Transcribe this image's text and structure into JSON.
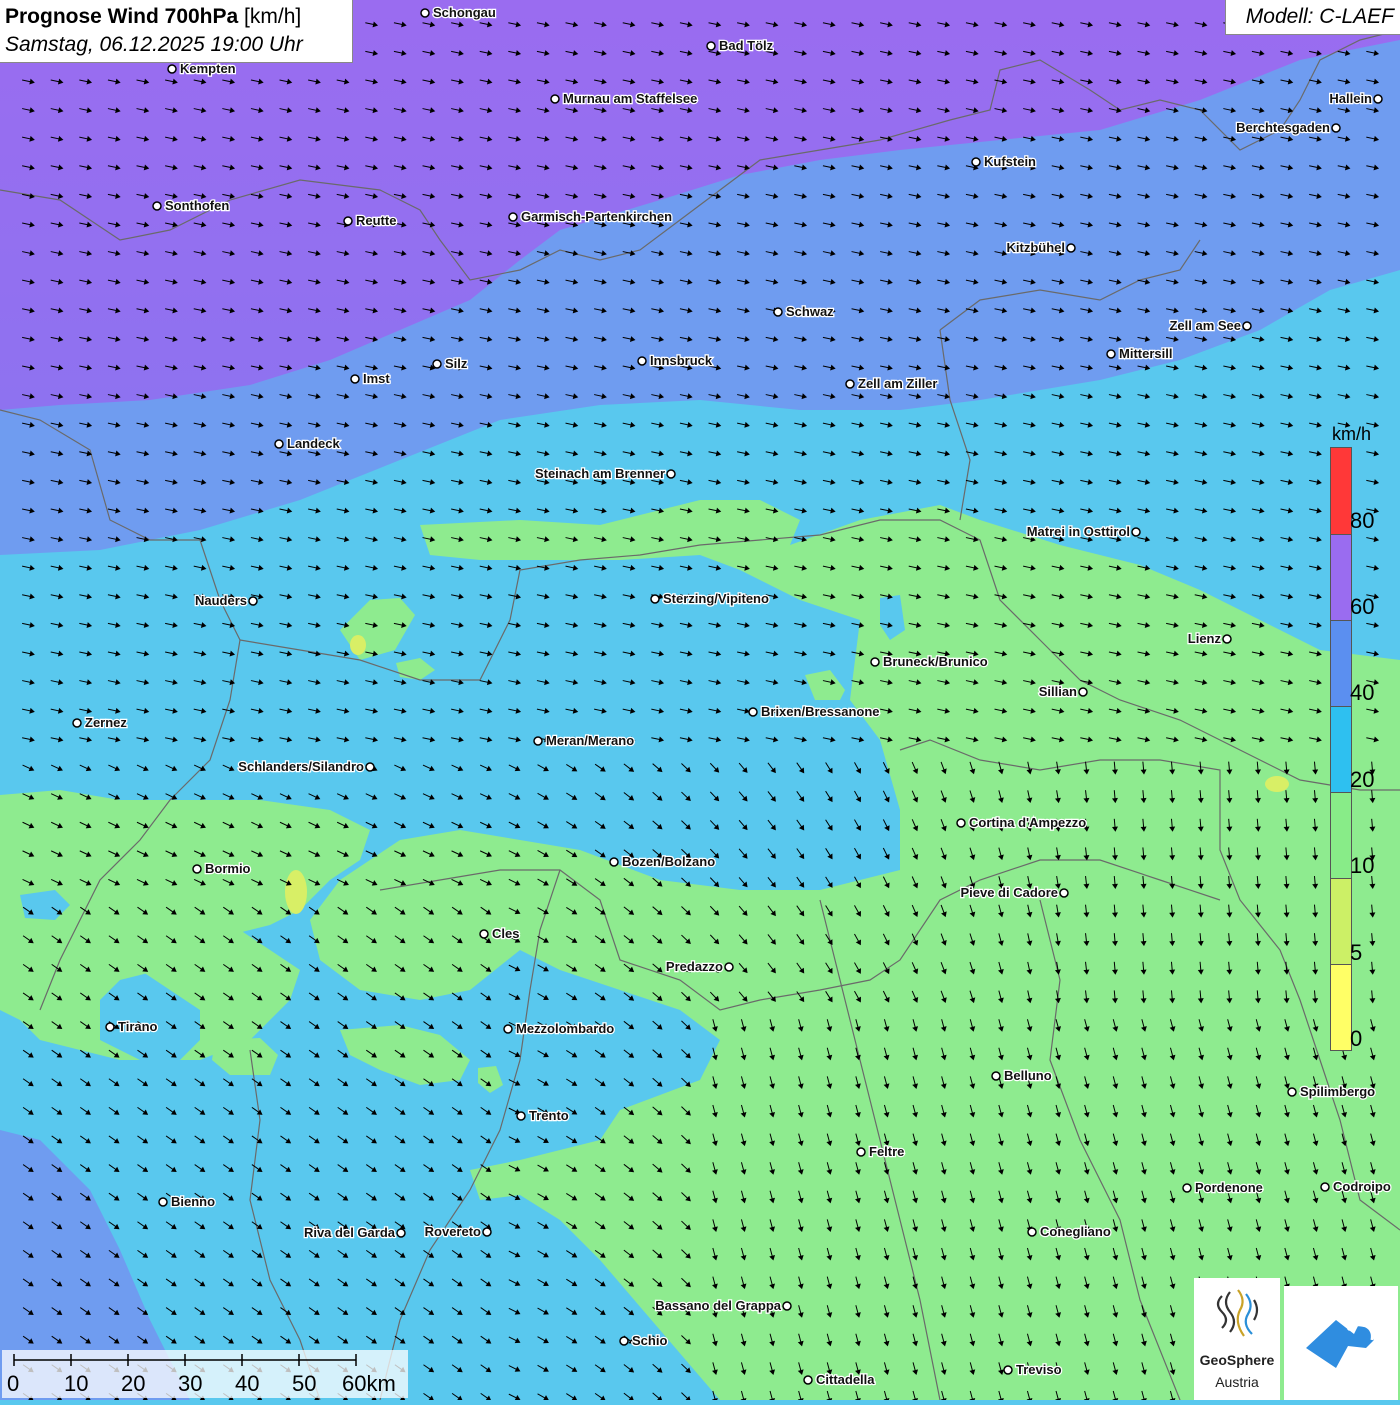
{
  "header": {
    "title_bold": "Prognose Wind 700hPa",
    "title_unit": "[km/h]",
    "datetime": "Samstag, 06.12.2025 19:00 Uhr",
    "model": "Modell: C-LAEF"
  },
  "legend": {
    "unit": "km/h",
    "ticks": [
      "0",
      "5",
      "10",
      "20",
      "40",
      "60",
      "80"
    ],
    "colors": [
      "#ffff66",
      "#ccf066",
      "#88ec88",
      "#2ec0f0",
      "#5b8ff0",
      "#9a6cf0",
      "#ff3838"
    ]
  },
  "scale": {
    "labels": [
      "0",
      "10",
      "20",
      "30",
      "40",
      "50",
      "60km"
    ]
  },
  "logos": {
    "geosphere_name": "GeoSphere",
    "geosphere_sub": "Austria"
  },
  "map": {
    "wind_direction": "west-northwest to east-southeast, turning north-to-south over the southeast",
    "cities": [
      "Schongau",
      "Bad Tölz",
      "Kempten",
      "Murnau am Staffelsee",
      "Hallein",
      "Berchtesgaden",
      "Kufstein",
      "Sonthofen",
      "Reutte",
      "Garmisch-Partenkirchen",
      "Kitzbühel",
      "Schwaz",
      "Zell am See",
      "Mittersill",
      "Innsbruck",
      "Silz",
      "Imst",
      "Zell am Ziller",
      "Landeck",
      "Steinach am Brenner",
      "Matrei in Osttirol",
      "Nauders",
      "Sterzing/Vipiteno",
      "Lienz",
      "Bruneck/Brunico",
      "Sillian",
      "Brixen/Bressanone",
      "Zernez",
      "Meran/Merano",
      "Schlanders/Silandro",
      "Cortina d'Ampezzo",
      "Bozen/Bolzano",
      "Bormio",
      "Pieve di Cadore",
      "Cles",
      "Predazzo",
      "Tirano",
      "Mezzolombardo",
      "Belluno",
      "Spilimbergo",
      "Trento",
      "Feltre",
      "Bienno",
      "Pordenone",
      "Codroipo",
      "Riva del Garda",
      "Rovereto",
      "Conegliano",
      "Bassano del Grappa",
      "Schio",
      "Treviso",
      "Cittadella"
    ]
  }
}
